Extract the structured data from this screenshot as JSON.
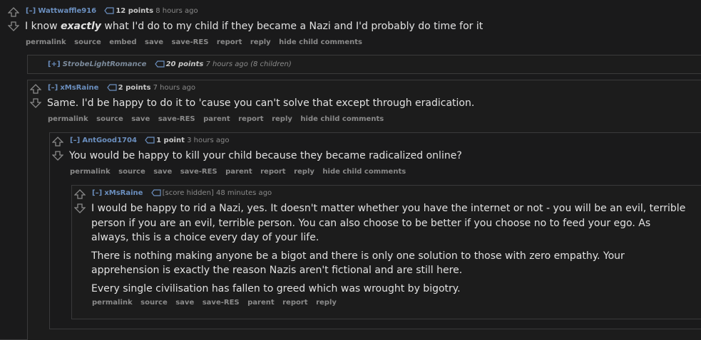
{
  "comment1": {
    "expand": "[–]",
    "author": "Wattwaffle916",
    "score": "12 points",
    "age": "8 hours ago",
    "body_before": "I know ",
    "body_em": "exactly",
    "body_after": " what I'd do to my child if they became a Nazi and I'd probably do time for it",
    "buttons": [
      "permalink",
      "source",
      "embed",
      "save",
      "save-RES",
      "report",
      "reply",
      "hide child comments"
    ]
  },
  "collapsed": {
    "expand": "[+]",
    "author": "StrobeLightRomance",
    "score": "20 points",
    "age": "7 hours ago",
    "children": "(8 children)"
  },
  "comment2": {
    "expand": "[–]",
    "author": "xMsRaine",
    "score": "2 points",
    "age": "7 hours ago",
    "body": "Same. I'd be happy to do it to 'cause you can't solve that except through eradication.",
    "buttons": [
      "permalink",
      "source",
      "save",
      "save-RES",
      "parent",
      "report",
      "reply",
      "hide child comments"
    ]
  },
  "comment3": {
    "expand": "[–]",
    "author": "AntGood1704",
    "score": "1 point",
    "age": "3 hours ago",
    "body": "You would be happy to kill your child because they became radicalized online?",
    "buttons": [
      "permalink",
      "source",
      "save",
      "save-RES",
      "parent",
      "report",
      "reply",
      "hide child comments"
    ]
  },
  "comment4": {
    "expand": "[–]",
    "author": "xMsRaine",
    "score": "[score hidden]",
    "age": "48 minutes ago",
    "paragraphs": [
      "I would be happy to rid a Nazi, yes. It doesn't matter whether you have the internet or not - you will be an evil, terrible person if you are an evil, terrible person. You can also choose to be better if you choose no to feed your ego. As always, this is a choice every day of your life.",
      "There is nothing making anyone be a bigot and there is only one solution to those with zero empathy. Your apprehension is exactly the reason Nazis aren't fictional and are still here.",
      "Every single civilisation has fallen to greed which was wrought by bigotry."
    ],
    "buttons": [
      "permalink",
      "source",
      "save",
      "save-RES",
      "parent",
      "report",
      "reply"
    ]
  },
  "colors": {
    "background": "#1a1a1b",
    "author": "#6b8fbf",
    "text": "#e1e1e1",
    "muted": "#8a8a8a"
  }
}
